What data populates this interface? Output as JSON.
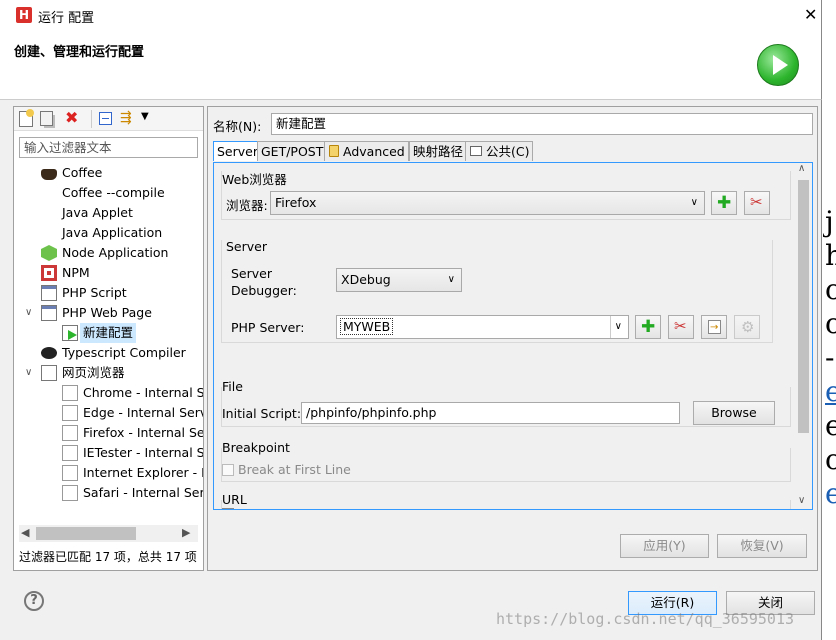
{
  "window": {
    "title": "运行 配置",
    "close": "✕"
  },
  "header": {
    "title": "创建、管理和运行配置"
  },
  "left": {
    "filter_placeholder": "输入过滤器文本",
    "status": "过滤器已匹配 17 项，总共 17 项",
    "tree": [
      {
        "label": "Coffee",
        "indent": 0,
        "icon": "coffee-icon"
      },
      {
        "label": "Coffee --compile",
        "indent": 0,
        "icon": "none"
      },
      {
        "label": "Java Applet",
        "indent": 0,
        "icon": "none"
      },
      {
        "label": "Java Application",
        "indent": 0,
        "icon": "none"
      },
      {
        "label": "Node Application",
        "indent": 0,
        "icon": "node-icon"
      },
      {
        "label": "NPM",
        "indent": 0,
        "icon": "npm-icon"
      },
      {
        "label": "PHP Script",
        "indent": 0,
        "icon": "php-script-icon"
      },
      {
        "label": "PHP Web Page",
        "indent": 0,
        "icon": "php-web-icon",
        "expanded": true
      },
      {
        "label": "新建配置",
        "indent": 1,
        "icon": "launch-config-icon",
        "selected": true
      },
      {
        "label": "Typescript Compiler",
        "indent": 0,
        "icon": "typescript-icon"
      },
      {
        "label": "网页浏览器",
        "indent": 0,
        "icon": "browser-folder-icon",
        "expanded": true
      },
      {
        "label": "Chrome - Internal Se",
        "indent": 1,
        "icon": "page-icon"
      },
      {
        "label": "Edge - Internal Serv",
        "indent": 1,
        "icon": "page-icon"
      },
      {
        "label": "Firefox - Internal Ser",
        "indent": 1,
        "icon": "page-icon"
      },
      {
        "label": "IETester - Internal S",
        "indent": 1,
        "icon": "page-icon"
      },
      {
        "label": "Internet Explorer - I",
        "indent": 1,
        "icon": "page-icon"
      },
      {
        "label": "Safari - Internal Serv",
        "indent": 1,
        "icon": "page-icon"
      }
    ]
  },
  "right": {
    "name_label": "名称(N):",
    "name_value": "新建配置",
    "tabs": [
      "Server",
      "GET/POST",
      "Advanced",
      "映射路径",
      "公共(C)"
    ],
    "web_browser_group": "Web浏览器",
    "browser_label": "浏览器:",
    "browser_value": "Firefox",
    "server_group": "Server",
    "server_debugger_label_1": "Server",
    "server_debugger_label_2": "Debugger:",
    "debugger_value": "XDebug",
    "php_server_label": "PHP Server:",
    "php_server_value": "MYWEB",
    "file_group": "File",
    "initial_script_label": "Initial Script:",
    "initial_script_value": "/phpinfo/phpinfo.php",
    "browse_button": "Browse",
    "breakpoint_group": "Breakpoint",
    "break_first_line": "Break at First Line",
    "url_group": "URL",
    "apply_button": "应用(Y)",
    "revert_button": "恢复(V)"
  },
  "footer": {
    "run_button": "运行(R)",
    "close_button": "关闭"
  },
  "watermark": "https://blog.csdn.net/qq_36595013",
  "colors": {
    "accent": "#3399ff",
    "run_green": "#2db52d",
    "selected_bg": "#cce8ff"
  }
}
